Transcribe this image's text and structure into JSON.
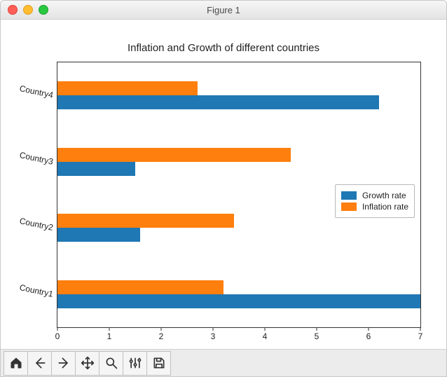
{
  "window": {
    "title": "Figure 1"
  },
  "toolbar": {
    "home": "Home",
    "back": "Back",
    "forward": "Forward",
    "pan": "Pan",
    "zoom": "Zoom",
    "configure": "Configure",
    "save": "Save"
  },
  "legend": {
    "growth": "Growth rate",
    "inflation": "Inflation rate"
  },
  "chart_data": {
    "type": "bar",
    "orientation": "horizontal",
    "title": "Inflation and Growth of different countries",
    "xlabel": "",
    "ylabel": "",
    "xlim": [
      0,
      7
    ],
    "xticks": [
      0,
      1,
      2,
      3,
      4,
      5,
      6,
      7
    ],
    "categories": [
      "Country1",
      "Country2",
      "Country3",
      "Country4"
    ],
    "series": [
      {
        "name": "Growth rate",
        "color": "#1f77b4",
        "values": [
          7.0,
          1.6,
          1.5,
          6.2
        ]
      },
      {
        "name": "Inflation rate",
        "color": "#ff7f0e",
        "values": [
          3.2,
          3.4,
          4.5,
          2.7
        ]
      }
    ],
    "legend_position": "right"
  }
}
